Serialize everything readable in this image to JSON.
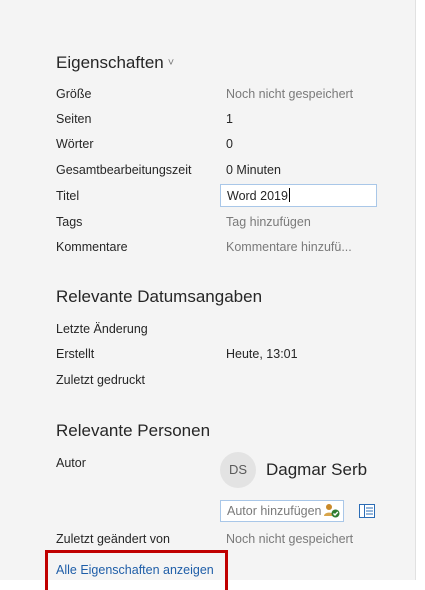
{
  "properties": {
    "heading": "Eigenschaften",
    "heading_chevron": "˅",
    "rows": [
      {
        "label": "Größe",
        "value": "Noch nicht gespeichert"
      },
      {
        "label": "Seiten",
        "value": "1"
      },
      {
        "label": "Wörter",
        "value": "0"
      },
      {
        "label": "Gesamtbearbeitungszeit",
        "value": "0 Minuten"
      },
      {
        "label": "Titel",
        "value": "Word 2019"
      },
      {
        "label": "Tags",
        "value": "Tag hinzufügen"
      },
      {
        "label": "Kommentare",
        "value": "Kommentare hinzufü..."
      }
    ]
  },
  "dates": {
    "heading": "Relevante Datumsangaben",
    "rows": [
      {
        "label": "Letzte Änderung",
        "value": ""
      },
      {
        "label": "Erstellt",
        "value": "Heute, 13:01"
      },
      {
        "label": "Zuletzt gedruckt",
        "value": ""
      }
    ]
  },
  "people": {
    "heading": "Relevante Personen",
    "author_label": "Autor",
    "author_initials": "DS",
    "author_name": "Dagmar Serb",
    "add_author_placeholder": "Autor hinzufügen",
    "last_modified_label": "Zuletzt geändert von",
    "last_modified_value": "Noch nicht gespeichert"
  },
  "show_all_link": "Alle Eigenschaften anzeigen",
  "colors": {
    "link": "#1f5ea8",
    "highlight": "#c00000",
    "muted": "#7a7a7a"
  }
}
